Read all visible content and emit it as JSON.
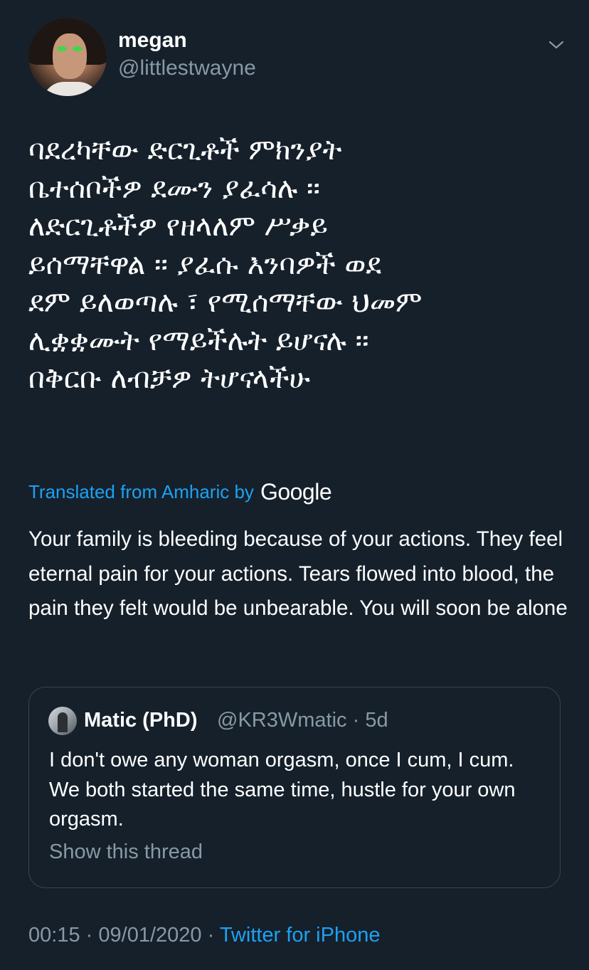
{
  "author": {
    "name": "megan",
    "handle": "@littlestwayne"
  },
  "tweet": {
    "original_text": "ባደረካቸው ድርጊቶች ምክንያት\nቤተሰቦችዎ ደሙን ያፈሳሉ ፡፡\nለድርጊቶችዎ የዘላለም ሥቃይ\nይሰማቸዋል ፡፡ ያፈሱ እንባዎች ወደ\nደም ይለወጣሉ ፣ የሚሰማቸው ህመም\nሊቋቋሙት የማይችሉት ይሆናሉ ፡፡\nበቅርቡ ለብቻዎ ትሆናላችሁ",
    "translated_label": "Translated from Amharic by",
    "translator": "Google",
    "translation_text": "Your family is bleeding because of your actions. They feel eternal pain for your actions. Tears flowed into blood, the pain they felt would be unbearable. You will soon be alone"
  },
  "quoted_tweet": {
    "name": "Matic (PhD)",
    "handle": "@KR3Wmatic",
    "separator": "·",
    "time": "5d",
    "text": "I don't owe any woman orgasm, once I cum, I cum. We both started the same time, hustle for your own orgasm.",
    "show_thread": "Show this thread"
  },
  "footer": {
    "time": "00:15",
    "separator": "·",
    "date": "09/01/2020",
    "source": "Twitter for iPhone"
  },
  "icons": {
    "menu": "chevron-down-icon"
  },
  "colors": {
    "background": "#15202b",
    "accent": "#1da1f2",
    "muted": "#8899a6",
    "border": "#38444d"
  }
}
